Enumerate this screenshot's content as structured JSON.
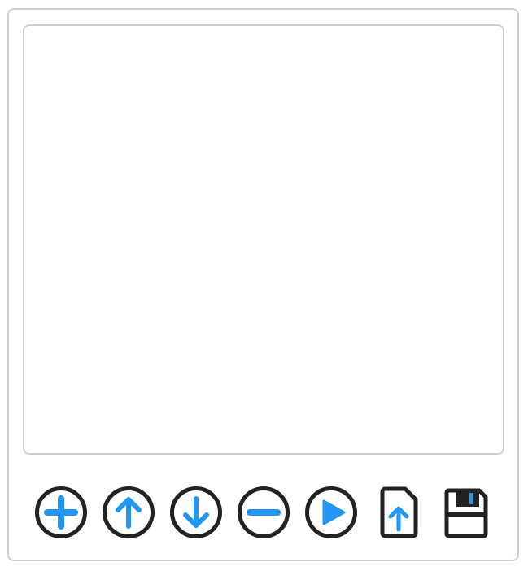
{
  "panel": {
    "list_items": []
  },
  "toolbar": {
    "buttons": [
      {
        "id": "add",
        "icon": "plus-circle-icon"
      },
      {
        "id": "move-up",
        "icon": "arrow-up-circle-icon"
      },
      {
        "id": "move-down",
        "icon": "arrow-down-circle-icon"
      },
      {
        "id": "remove",
        "icon": "minus-circle-icon"
      },
      {
        "id": "play",
        "icon": "play-circle-icon"
      },
      {
        "id": "upload",
        "icon": "file-upload-icon"
      },
      {
        "id": "save",
        "icon": "floppy-disk-icon"
      }
    ]
  },
  "colors": {
    "accent": "#2196f3",
    "outline": "#222222",
    "border": "#cfcfcf"
  }
}
